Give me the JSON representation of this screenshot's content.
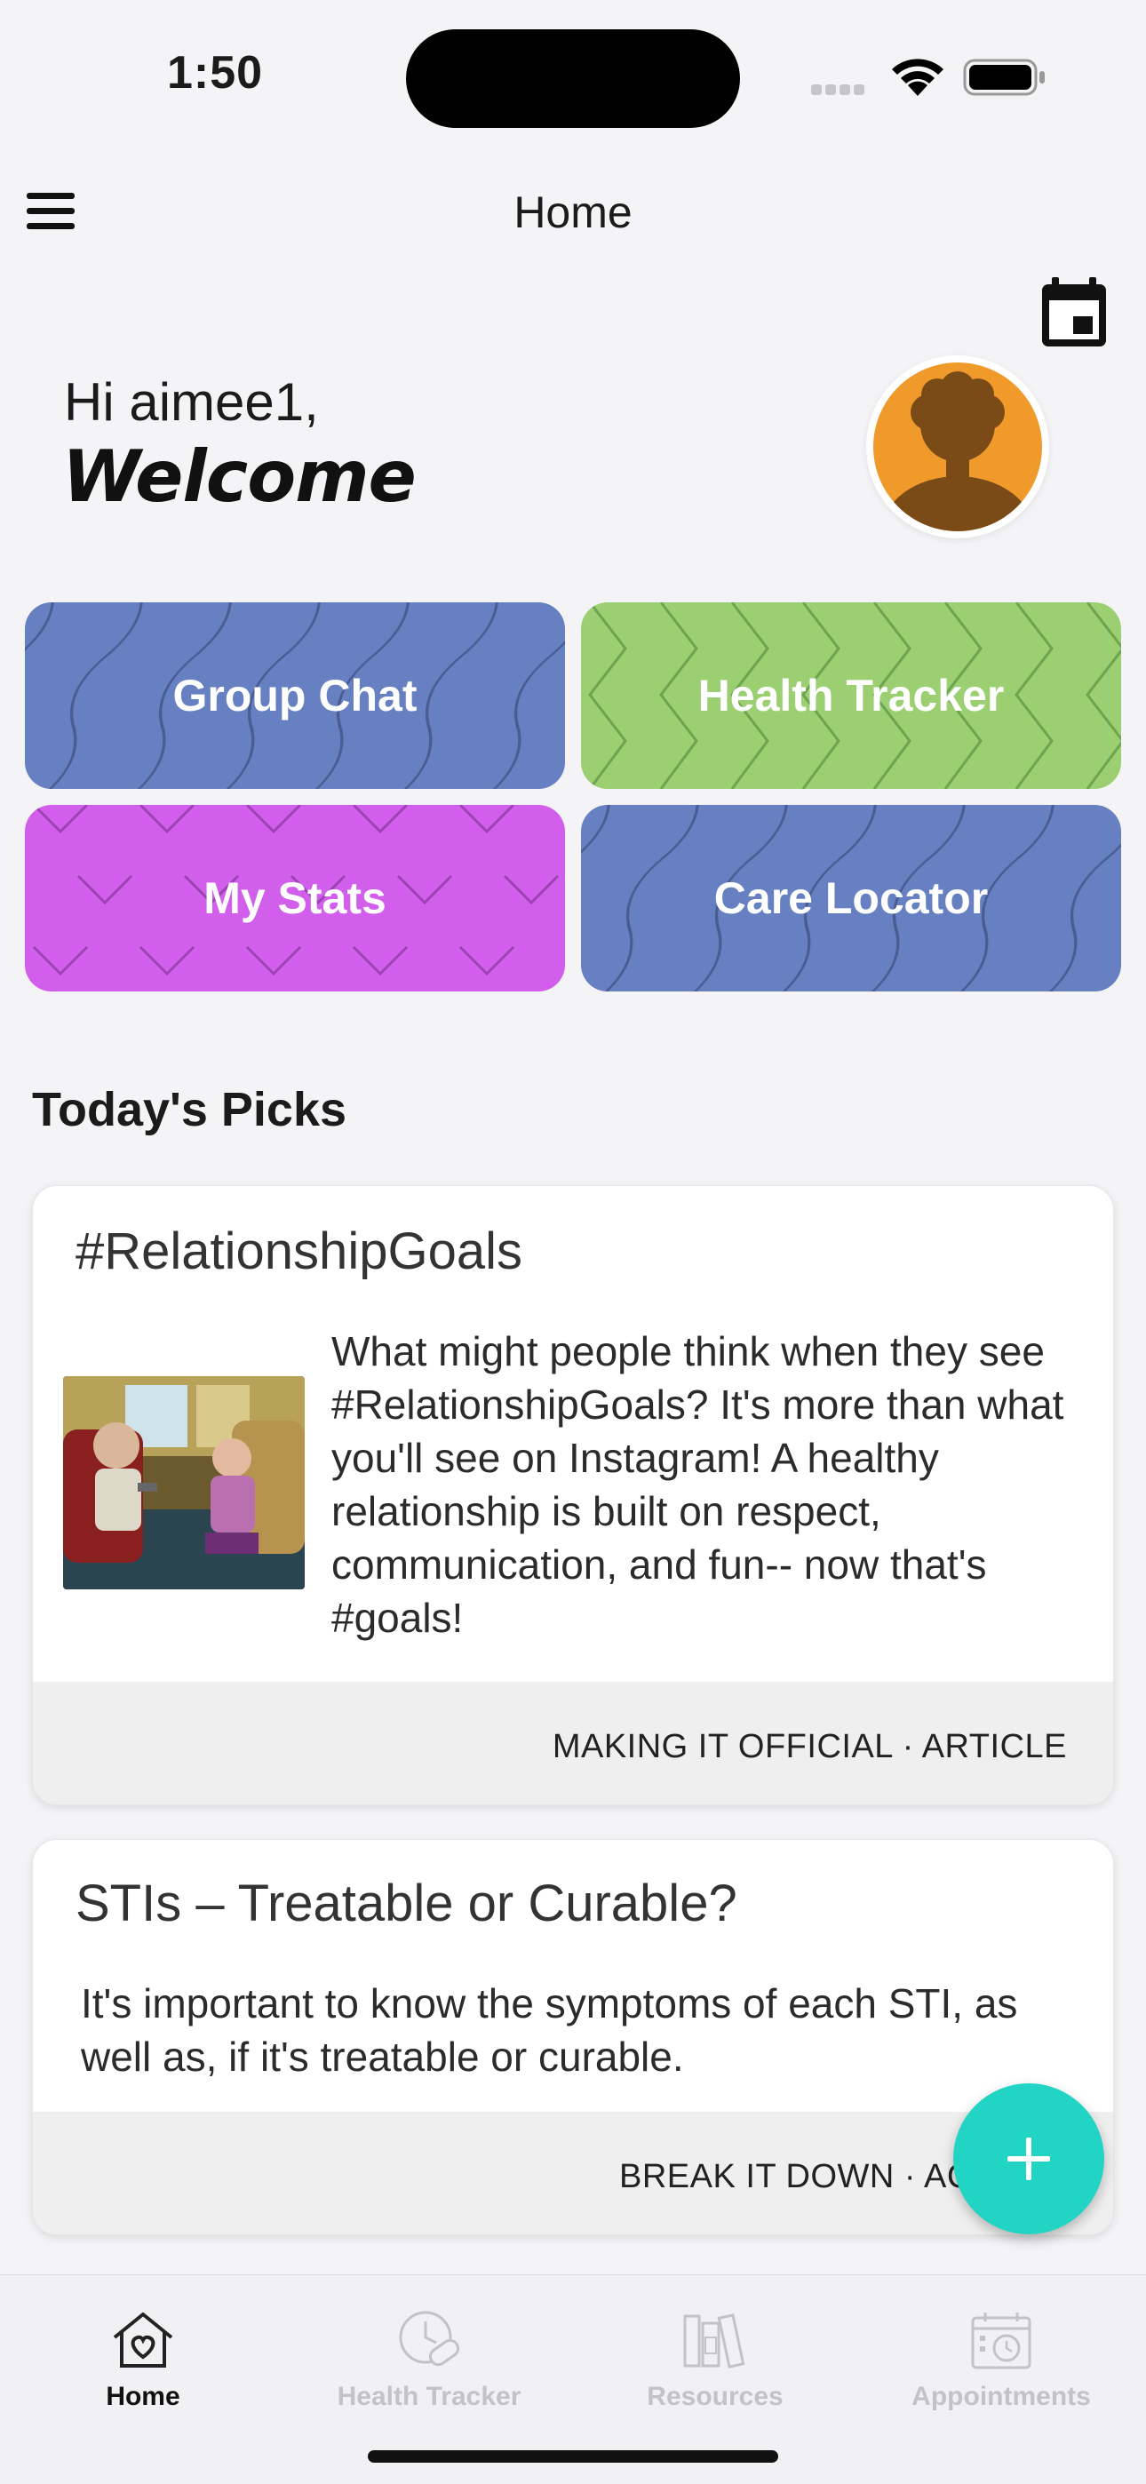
{
  "status_bar": {
    "time": "1:50"
  },
  "header": {
    "title": "Home"
  },
  "greeting": {
    "line1": "Hi aimee1,",
    "line2": "Welcome"
  },
  "tiles": [
    {
      "label": "Group Chat",
      "color": "#6680c2"
    },
    {
      "label": "Health Tracker",
      "color": "#9bcf72"
    },
    {
      "label": "My Stats",
      "color": "#d15fec"
    },
    {
      "label": "Care Locator",
      "color": "#6680c2"
    }
  ],
  "section": {
    "title": "Today's Picks"
  },
  "cards": [
    {
      "title": "#RelationshipGoals",
      "text": "What might people think when they see #RelationshipGoals? It's more than what you'll see on Instagram! A healthy relationship is built on respect, communication, and fun-- now that's #goals!",
      "footer": "MAKING IT OFFICIAL · ARTICLE"
    },
    {
      "title": "STIs – Treatable or Curable?",
      "text": "It's important to know the symptoms of each STI, as well as, if it's treatable or curable.",
      "footer": "BREAK IT DOWN · AC"
    }
  ],
  "fab": {
    "icon": "plus-icon",
    "color": "#21d4c4"
  },
  "tab_bar": {
    "items": [
      {
        "label": "Home",
        "icon": "home-heart-icon",
        "active": true
      },
      {
        "label": "Health Tracker",
        "icon": "clock-pill-icon",
        "active": false
      },
      {
        "label": "Resources",
        "icon": "books-icon",
        "active": false
      },
      {
        "label": "Appointments",
        "icon": "calendar-clock-icon",
        "active": false
      }
    ]
  }
}
